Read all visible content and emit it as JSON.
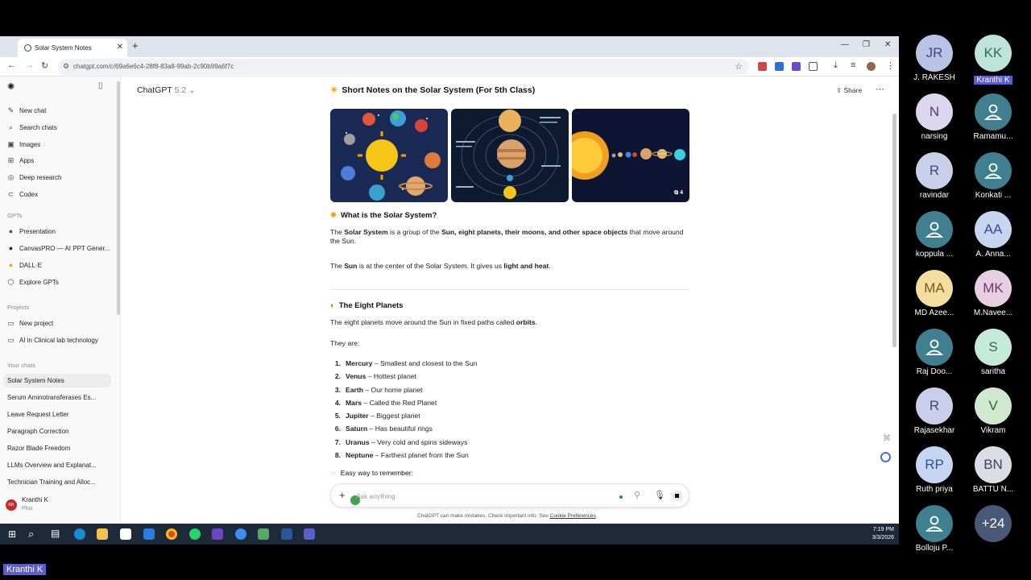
{
  "browser": {
    "tab_title": "Solar System Notes",
    "url": "chatgpt.com/c/69a6e6c4-28f8-83a8-99ab-2c90b99a6f7c"
  },
  "sidebar": {
    "top_items": [
      {
        "label": "New chat",
        "icon": "compose-icon"
      },
      {
        "label": "Search chats",
        "icon": "search-icon"
      },
      {
        "label": "Images",
        "icon": "image-icon"
      },
      {
        "label": "Apps",
        "icon": "apps-icon"
      },
      {
        "label": "Deep research",
        "icon": "research-icon"
      },
      {
        "label": "Codex",
        "icon": "codex-icon"
      }
    ],
    "gpts_heading": "GPTs",
    "gpts": [
      "Presentation",
      "CanvasPRO — AI PPT Gener...",
      "DALL·E",
      "Explore GPTs"
    ],
    "projects_heading": "Projects",
    "projects": [
      "New project",
      "AI in Clinical lab technology"
    ],
    "chats_heading": "Your chats",
    "chats": [
      "Solar System Notes",
      "Serum Aminotransferases Es...",
      "Leave Request Letter",
      "Paragraph Correction",
      "Razor Blade Freedom",
      "LLMs Overview and Explanat...",
      "Technician Training and Alloc..."
    ],
    "user_name": "Kranthi K",
    "user_plan": "Plus",
    "user_initials": "KK"
  },
  "header": {
    "model": "ChatGPT",
    "model_version": "5.2",
    "share_label": "Share"
  },
  "content": {
    "title": "Short Notes on the Solar System (For 5th Class)",
    "image_count": "4",
    "what_heading": "What is the Solar System?",
    "p1_a": "The ",
    "p1_b": "Solar System",
    "p1_c": " is a group of the ",
    "p1_d": "Sun, eight planets, their moons, and other space objects",
    "p1_e": " that move around the Sun.",
    "p2_a": "The ",
    "p2_b": "Sun",
    "p2_c": " is at the center of the Solar System. It gives us ",
    "p2_d": "light and heat",
    "p2_e": ".",
    "planets_heading": "The Eight Planets",
    "p3_a": "The eight planets move around the Sun in fixed paths called ",
    "p3_b": "orbits",
    "p3_c": ".",
    "they_are": "They are:",
    "planets": [
      {
        "n": "1.",
        "name": "Mercury",
        "desc": " – Smallest and closest to the Sun"
      },
      {
        "n": "2.",
        "name": "Venus",
        "desc": " – Hottest planet"
      },
      {
        "n": "3.",
        "name": "Earth",
        "desc": " – Our home planet"
      },
      {
        "n": "4.",
        "name": "Mars",
        "desc": " – Called the Red Planet"
      },
      {
        "n": "5.",
        "name": "Jupiter",
        "desc": " – Biggest planet"
      },
      {
        "n": "6.",
        "name": "Saturn",
        "desc": " – Has beautiful rings"
      },
      {
        "n": "7.",
        "name": "Uranus",
        "desc": " – Very cold and spins sideways"
      },
      {
        "n": "8.",
        "name": "Neptune",
        "desc": " – Farthest planet from the Sun"
      }
    ],
    "easy_way": "Easy way to remember:"
  },
  "composer": {
    "placeholder": "Ask anything",
    "disclaimer": "ChatGPT can make mistakes. Check important info. See ",
    "disclaimer_link": "Cookie Preferences",
    "disclaimer_end": "."
  },
  "taskbar": {
    "time": "7:19 PM",
    "date": "3/3/2026"
  },
  "participants": [
    {
      "initials": "JR",
      "name": "J. RAKESH",
      "color": "#b9c3e6",
      "text": "#3f4a7a"
    },
    {
      "initials": "KK",
      "name": "Kranthi K",
      "color": "#bfe3d8",
      "text": "#2c6b58",
      "highlight": true
    },
    {
      "initials": "N",
      "name": "narsing",
      "color": "#dcd6ef",
      "text": "#4b4370"
    },
    {
      "initials": "",
      "name": "Ramamu...",
      "color": "#3f7f8f",
      "text": "#fff",
      "icon": true
    },
    {
      "initials": "R",
      "name": "ravindar",
      "color": "#c9cfe8",
      "text": "#3f4a7a"
    },
    {
      "initials": "",
      "name": "Konkati ...",
      "color": "#3f7f8f",
      "text": "#fff",
      "icon": true
    },
    {
      "initials": "",
      "name": "koppula ...",
      "color": "#3f7f8f",
      "text": "#fff",
      "icon": true
    },
    {
      "initials": "AA",
      "name": "A. Anna...",
      "color": "#c6d6f0",
      "text": "#34508a"
    },
    {
      "initials": "MA",
      "name": "MD Azee...",
      "color": "#f3deA0",
      "text": "#7a5a12"
    },
    {
      "initials": "MK",
      "name": "M.Navee...",
      "color": "#e6cfe3",
      "text": "#6b3a63"
    },
    {
      "initials": "",
      "name": "Raj Doo...",
      "color": "#3f7f8f",
      "text": "#fff",
      "icon": true
    },
    {
      "initials": "S",
      "name": "saritha",
      "color": "#c7ead8",
      "text": "#2b6b4a"
    },
    {
      "initials": "R",
      "name": "Rajasekhar",
      "color": "#c9cfe8",
      "text": "#3f4a7a"
    },
    {
      "initials": "V",
      "name": "Vikram",
      "color": "#cfe8cf",
      "text": "#2f6a2f"
    },
    {
      "initials": "RP",
      "name": "Ruth priya",
      "color": "#c6d6f0",
      "text": "#34508a"
    },
    {
      "initials": "BN",
      "name": "BATTU N...",
      "color": "#d9dde6",
      "text": "#3b4455"
    },
    {
      "initials": "",
      "name": "Bolloju P...",
      "color": "#3f7f8f",
      "text": "#fff",
      "icon": true
    },
    {
      "initials": "+24",
      "name": "",
      "color": "#4a5878",
      "text": "#fff"
    }
  ],
  "self_name": "Kranthi K"
}
